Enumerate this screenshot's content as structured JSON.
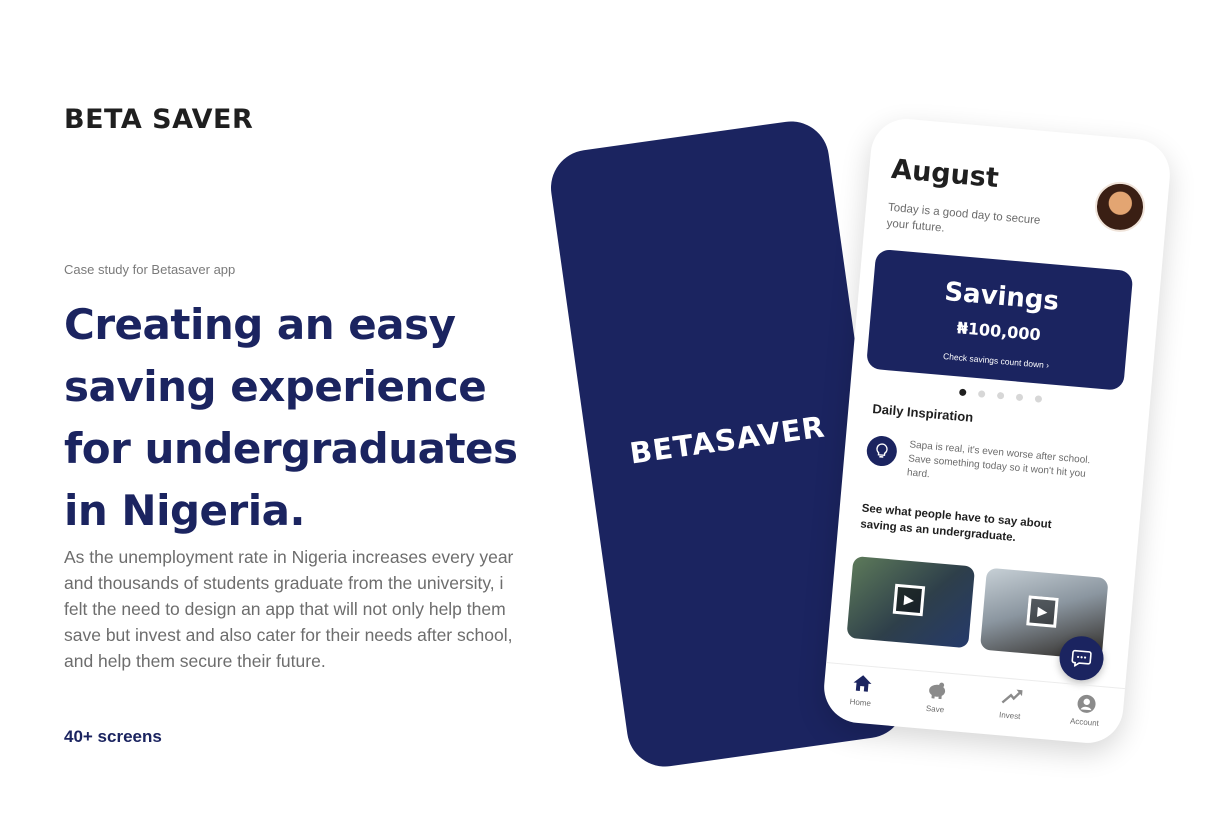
{
  "brand": "BETA SAVER",
  "case_study": "Case study for Betasaver app",
  "headline": "Creating an easy saving  experience for undergraduates in Nigeria.",
  "description": "As the unemployment rate in Nigeria increases every year and thousands of students graduate from the university, i felt the need to design an app that will not only help them save but invest and also cater for their needs after school, and help them secure their future.",
  "screens_count": "40+ screens",
  "splash": {
    "logo": "BETASAVER",
    "color": "#1b2460"
  },
  "phone": {
    "month": "August",
    "subtitle": "Today is a good day to secure your future.",
    "savings": {
      "title": "Savings",
      "amount": "₦100,000",
      "link": "Check savings count down  ›"
    },
    "carousel": {
      "total": 5,
      "active": 1
    },
    "inspiration_title": "Daily Inspiration",
    "inspiration_icon": "lightbulb-icon",
    "inspiration_text": "Sapa is real, it's even worse after school. Save something today so it won't hit you hard.",
    "people_title": "See what people have to say about saving as an undergraduate.",
    "videos": [
      {
        "icon": "play-icon"
      },
      {
        "icon": "play-icon"
      }
    ],
    "chat_icon": "chat-bubble-icon",
    "nav": [
      {
        "label": "Home",
        "icon": "home-icon"
      },
      {
        "label": "Save",
        "icon": "piggy-bank-icon"
      },
      {
        "label": "Invest",
        "icon": "trend-up-icon"
      },
      {
        "label": "Account",
        "icon": "account-icon"
      }
    ]
  }
}
